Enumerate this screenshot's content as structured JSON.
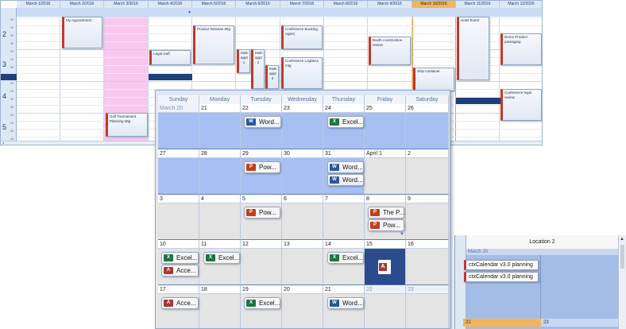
{
  "day_view": {
    "headers": [
      "March 1/2016",
      "March 2/2016",
      "March 3/2016",
      "March 4/2016",
      "March 5/2016",
      "March 6/2016",
      "March 7/2016",
      "March 8/2016",
      "March 9/2016",
      "March 10/2016",
      "March 11/2016",
      "March 12/2016"
    ],
    "today_index": 9,
    "hours": [
      "2",
      "3",
      "4",
      "5"
    ],
    "minutes": [
      "00",
      "15",
      "30",
      "45"
    ],
    "appointments": {
      "my_appointment": "My Appointment",
      "golf": "Golf Tournament Planning Mtg",
      "legal_stuff": "Legal stuff",
      "product_release": "Product Release Mtg",
      "multi_1": "Multi appt - 1",
      "multi_2": "Multi appt - 2",
      "multi_3": "Multi appt - 3",
      "conf_booking": "Conference Booking Agent",
      "conf_logistics": "Conference Logistics mtg",
      "booth": "Booth construction review",
      "ship": "Ship container",
      "hotel": "Hotel Event",
      "demo": "Demo Product packaging",
      "legal_review": "Conference legal review"
    }
  },
  "month_view": {
    "weekdays": [
      "Sunday",
      "Monday",
      "Tuesday",
      "Wednesday",
      "Thursday",
      "Friday",
      "Saturday"
    ],
    "weeks": [
      [
        "March 20",
        "21",
        "22",
        "23",
        "24",
        "25",
        "26"
      ],
      [
        "27",
        "28",
        "29",
        "30",
        "31",
        "April 1",
        "2"
      ],
      [
        "3",
        "4",
        "5",
        "6",
        "7",
        "8",
        "9"
      ],
      [
        "10",
        "11",
        "12",
        "13",
        "14",
        "15",
        "16"
      ],
      [
        "17",
        "18",
        "19",
        "20",
        "21",
        "22",
        "23"
      ]
    ],
    "chips": {
      "w0_tue": "Word...",
      "w0_thu": "Excel...",
      "w1_tue": "Pow...",
      "w1_thu_a": "Word...",
      "w1_thu_b": "Word...",
      "w2_tue": "Pow...",
      "w2_fri_a": "The P...",
      "w2_fri_b": "Pow...",
      "w3_sun_a": "Excel...",
      "w3_sun_b": "Acce...",
      "w3_mon": "Excel...",
      "w3_thu": "Excel...",
      "w4_sun": "Acce...",
      "w4_tue": "Excel...",
      "w4_thu": "Word..."
    },
    "colors": {
      "week_highlight": "#a7bff2",
      "selected_cell": "#2b4c8c"
    }
  },
  "resource_view": {
    "title": "Location 2",
    "sub_date": "March 20",
    "appointments": [
      "ctxCalendar v3.0 planning",
      "ctxCalendar v3.0 planning"
    ],
    "footer_dates": [
      "22",
      "23"
    ]
  }
}
